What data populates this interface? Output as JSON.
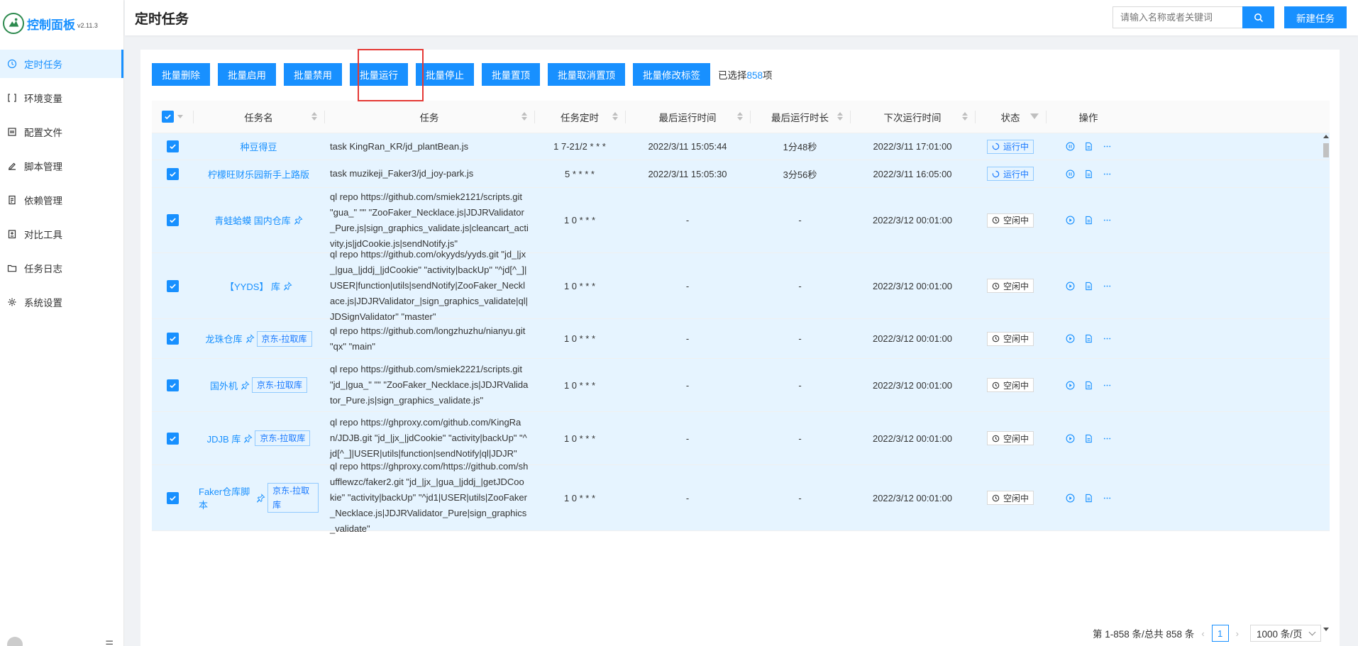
{
  "app": {
    "title": "控制面板",
    "version": "v2.11.3"
  },
  "sidebar": {
    "items": [
      {
        "label": "定时任务",
        "icon": "clock-icon",
        "active": true
      },
      {
        "label": "环境变量",
        "icon": "variable-icon"
      },
      {
        "label": "配置文件",
        "icon": "config-icon"
      },
      {
        "label": "脚本管理",
        "icon": "edit-icon"
      },
      {
        "label": "依赖管理",
        "icon": "package-icon"
      },
      {
        "label": "对比工具",
        "icon": "diff-icon"
      },
      {
        "label": "任务日志",
        "icon": "folder-icon"
      },
      {
        "label": "系统设置",
        "icon": "gear-icon"
      }
    ]
  },
  "header": {
    "title": "定时任务",
    "search_placeholder": "请输入名称或者关键词",
    "new_label": "新建任务"
  },
  "toolbar": {
    "buttons": [
      "批量删除",
      "批量启用",
      "批量禁用",
      "批量运行",
      "批量停止",
      "批量置顶",
      "批量取消置顶",
      "批量修改标签"
    ],
    "selected_prefix": "已选择",
    "selected_count": "858",
    "selected_suffix": "项"
  },
  "table": {
    "columns": [
      "任务名",
      "任务",
      "任务定时",
      "最后运行时间",
      "最后运行时长",
      "下次运行时间",
      "状态",
      "操作"
    ],
    "rows": [
      {
        "name": "种豆得豆",
        "pinned": false,
        "tag": "",
        "task": "task KingRan_KR/jd_plantBean.js",
        "schedule": "1 7-21/2 * * *",
        "last_run": "2022/3/11 15:05:44",
        "duration": "1分48秒",
        "next_run": "2022/3/11 17:01:00",
        "status": "运行中",
        "running": true
      },
      {
        "name": "柠檬旺财乐园新手上路版",
        "pinned": false,
        "tag": "",
        "task": "task muzikeji_Faker3/jd_joy-park.js",
        "schedule": "5 * * * *",
        "last_run": "2022/3/11 15:05:30",
        "duration": "3分56秒",
        "next_run": "2022/3/11 16:05:00",
        "status": "运行中",
        "running": true
      },
      {
        "name": "青蛙蛤蟆 国内仓库",
        "pinned": true,
        "tag": "",
        "task": "ql repo https://github.com/smiek2121/scripts.git \"gua_\" \"\" \"ZooFaker_Necklace.js|JDJRValidator_Pure.js|sign_graphics_validate.js|cleancart_activity.js|jdCookie.js|sendNotify.js\"",
        "schedule": "1 0 * * *",
        "last_run": "-",
        "duration": "-",
        "next_run": "2022/3/12 00:01:00",
        "status": "空闲中",
        "running": false
      },
      {
        "name": "【YYDS】 库",
        "pinned": true,
        "tag": "",
        "task": "ql repo https://github.com/okyyds/yyds.git \"jd_|jx_|gua_|jddj_|jdCookie\" \"activity|backUp\" \"^jd[^_]|USER|function|utils|sendNotify|ZooFaker_Necklace.js|JDJRValidator_|sign_graphics_validate|ql|JDSignValidator\" \"master\"",
        "schedule": "1 0 * * *",
        "last_run": "-",
        "duration": "-",
        "next_run": "2022/3/12 00:01:00",
        "status": "空闲中",
        "running": false
      },
      {
        "name": "龙珠仓库",
        "pinned": true,
        "tag": "京东-拉取库",
        "task": "ql repo https://github.com/longzhuzhu/nianyu.git \"qx\" \"main\"",
        "schedule": "1 0 * * *",
        "last_run": "-",
        "duration": "-",
        "next_run": "2022/3/12 00:01:00",
        "status": "空闲中",
        "running": false
      },
      {
        "name": "国外机",
        "pinned": true,
        "tag": "京东-拉取库",
        "task": "ql repo https://github.com/smiek2221/scripts.git \"jd_|gua_\" \"\" \"ZooFaker_Necklace.js|JDJRValidator_Pure.js|sign_graphics_validate.js\"",
        "schedule": "1 0 * * *",
        "last_run": "-",
        "duration": "-",
        "next_run": "2022/3/12 00:01:00",
        "status": "空闲中",
        "running": false
      },
      {
        "name": "JDJB 库",
        "pinned": true,
        "tag": "京东-拉取库",
        "task": "ql repo https://ghproxy.com/github.com/KingRan/JDJB.git \"jd_|jx_|jdCookie\" \"activity|backUp\" \"^jd[^_]|USER|utils|function|sendNotify|ql|JDJR\"",
        "schedule": "1 0 * * *",
        "last_run": "-",
        "duration": "-",
        "next_run": "2022/3/12 00:01:00",
        "status": "空闲中",
        "running": false
      },
      {
        "name": "Faker仓库脚本",
        "pinned": true,
        "tag": "京东-拉取库",
        "task": "ql repo https://ghproxy.com/https://github.com/shufflewzc/faker2.git \"jd_|jx_|gua_|jddj_|getJDCookie\" \"activity|backUp\" \"^jd1|USER|utils|ZooFaker_Necklace.js|JDJRValidator_Pure|sign_graphics_validate\"",
        "schedule": "1 0 * * *",
        "last_run": "-",
        "duration": "-",
        "next_run": "2022/3/12 00:01:00",
        "status": "空闲中",
        "running": false
      }
    ]
  },
  "pagination": {
    "summary": "第 1-858 条/总共 858 条",
    "current": "1",
    "page_size": "1000 条/页"
  },
  "colors": {
    "primary": "#1890ff",
    "selected_row": "#e6f4ff",
    "highlight": "#e53935"
  }
}
